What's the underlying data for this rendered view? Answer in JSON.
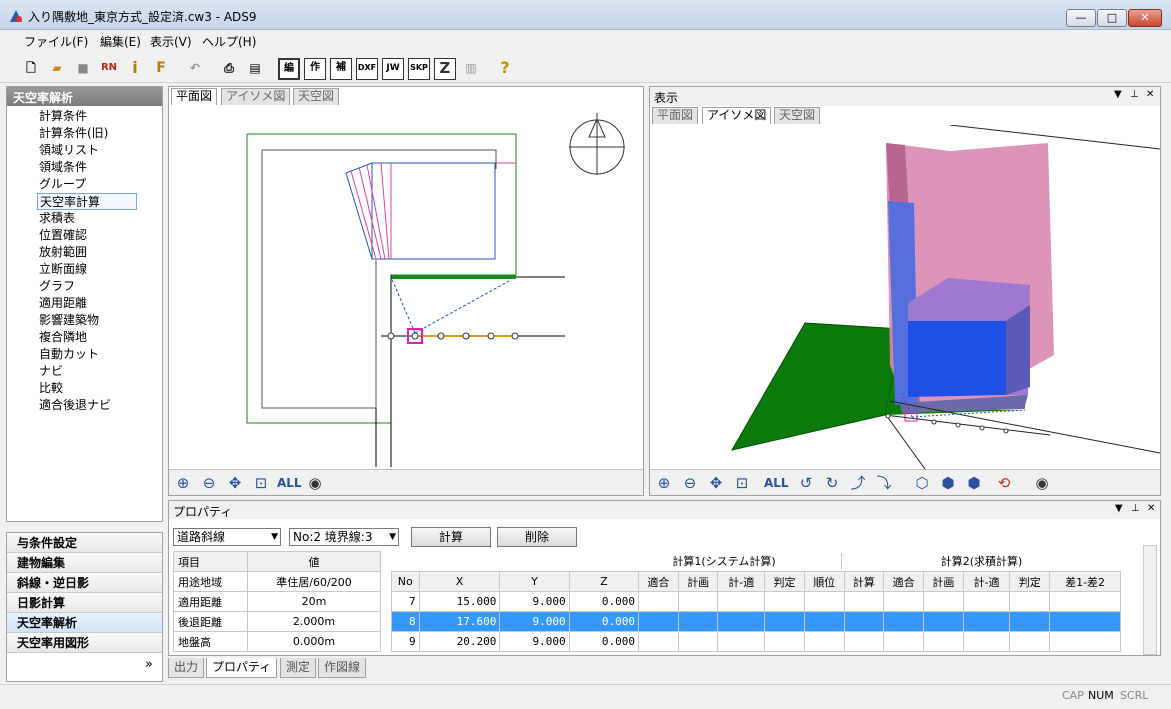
{
  "window": {
    "title": "入り隅敷地_東京方式_設定済.cw3 - ADS9"
  },
  "menu": [
    "ファイル(F)",
    "編集(E)",
    "表示(V)",
    "ヘルプ(H)"
  ],
  "toolbar": {
    "buttons": [
      "RN",
      "i",
      "F",
      "編",
      "作",
      "補",
      "DXF",
      "JW",
      "SKP",
      "Z",
      "?"
    ]
  },
  "nav": {
    "header": "天空率解析",
    "items": [
      "計算条件",
      "計算条件(旧)",
      "領域リスト",
      "領域条件",
      "グループ",
      "天空率計算",
      "求積表",
      "位置確認",
      "放射範囲",
      "立断面線",
      "グラフ",
      "適用距離",
      "影響建築物",
      "複合隣地",
      "自動カット",
      "ナビ",
      "比較",
      "適合後退ナビ"
    ],
    "selected_index": 5
  },
  "categories": {
    "items": [
      "与条件設定",
      "建物編集",
      "斜線・逆日影",
      "日影計算",
      "天空率解析",
      "天空率用図形"
    ],
    "selected_index": 4,
    "more": "»"
  },
  "planview": {
    "tabs": [
      "平面図",
      "アイソメ図",
      "天空図"
    ],
    "zoom_all": "ALL"
  },
  "isoview": {
    "title": "表示",
    "tabs": [
      "平面図",
      "アイソメ図",
      "天空図"
    ],
    "zoom_all": "ALL"
  },
  "properties": {
    "title": "プロパティ",
    "type_select": "道路斜線",
    "no_select": "No:2 境界線:3",
    "calc_button": "計算",
    "delete_button": "削除",
    "table_headers": [
      "項目",
      "値"
    ],
    "rows": [
      {
        "item": "用途地域",
        "value": "準住居/60/200"
      },
      {
        "item": "適用距離",
        "value": "20m"
      },
      {
        "item": "後退距離",
        "value": "2.000m"
      },
      {
        "item": "地盤高",
        "value": "0.000m"
      }
    ],
    "group1": "計算1(システム計算)",
    "group2": "計算2(求積計算)",
    "data_headers": [
      "No",
      "X",
      "Y",
      "Z",
      "適合",
      "計画",
      "計-適",
      "判定",
      "順位",
      "計算",
      "適合",
      "計画",
      "計-適",
      "判定",
      "差1-差2"
    ],
    "data_rows": [
      {
        "no": "7",
        "x": "15.000",
        "y": "9.000",
        "z": "0.000"
      },
      {
        "no": "8",
        "x": "17.600",
        "y": "9.000",
        "z": "0.000"
      },
      {
        "no": "9",
        "x": "20.200",
        "y": "9.000",
        "z": "0.000"
      }
    ],
    "selected_row": 1
  },
  "bottom_tabs": [
    "出力",
    "プロパティ",
    "測定",
    "作図線"
  ],
  "status": [
    "CAP",
    "NUM",
    "SCRL"
  ]
}
